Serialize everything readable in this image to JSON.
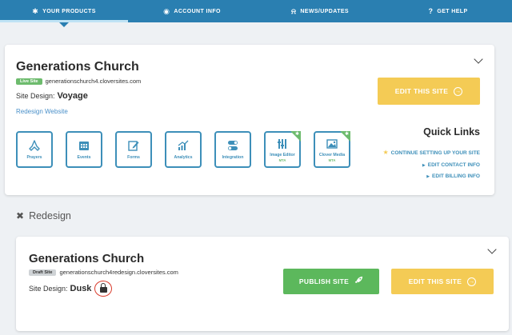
{
  "nav": {
    "items": [
      {
        "label": "YOUR PRODUCTS",
        "icon": "puzzle-icon",
        "glyph": "✱",
        "active": true
      },
      {
        "label": "ACCOUNT INFO",
        "icon": "user-circle-icon",
        "glyph": "◉"
      },
      {
        "label": "NEWS/UPDATES",
        "icon": "bell-icon",
        "glyph": "⍾"
      },
      {
        "label": "GET HELP",
        "icon": "help-circle-icon",
        "glyph": "?"
      }
    ],
    "colors": {
      "bar": "#2a7fb1",
      "active_underline": "#bfe3f5"
    }
  },
  "live_site": {
    "name": "Generations Church",
    "badge": "Live Site",
    "url": "generationschurch4.cloversites.com",
    "design_label": "Site Design:",
    "design_value": "Voyage",
    "redesign_link": "Redesign Website",
    "edit_button": "EDIT THIS SITE",
    "tools": [
      {
        "label": "Prayers",
        "icon": "praying-hands-icon",
        "glyph": "🙏"
      },
      {
        "label": "Events",
        "icon": "calendar-icon",
        "glyph": "▦"
      },
      {
        "label": "Forms",
        "icon": "edit-form-icon",
        "glyph": "✎"
      },
      {
        "label": "Analytics",
        "icon": "chart-up-icon",
        "glyph": "📈"
      },
      {
        "label": "Integration",
        "icon": "toggle-icon",
        "glyph": "⚙"
      },
      {
        "label": "Image Editor",
        "sub": "MTA",
        "icon": "image-editor-icon",
        "glyph": "▥",
        "new": true
      },
      {
        "label": "Clover Media",
        "sub": "MTA",
        "icon": "media-image-icon",
        "glyph": "▣",
        "new": true
      }
    ]
  },
  "quick_links": {
    "title": "Quick Links",
    "items": [
      {
        "label": "CONTINUE SETTING UP YOUR SITE",
        "icon": "star-icon",
        "glyph": "★"
      },
      {
        "label": "EDIT CONTACT INFO",
        "icon": "arrow-right-icon",
        "glyph": "▶"
      },
      {
        "label": "EDIT BILLING INFO",
        "icon": "arrow-right-icon",
        "glyph": "▶"
      }
    ]
  },
  "redesign": {
    "heading": "Redesign",
    "name": "Generations Church",
    "badge": "Draft Site",
    "url": "generationschurch4redesign.cloversites.com",
    "design_label": "Site Design:",
    "design_value": "Dusk",
    "publish_button": "PUBLISH SITE",
    "edit_button": "EDIT THIS SITE"
  },
  "colors": {
    "accent_yellow": "#f4cb55",
    "accent_green": "#5cb85c",
    "tool_blue": "#3d8fb9",
    "highlight_red": "#d93a2b"
  }
}
